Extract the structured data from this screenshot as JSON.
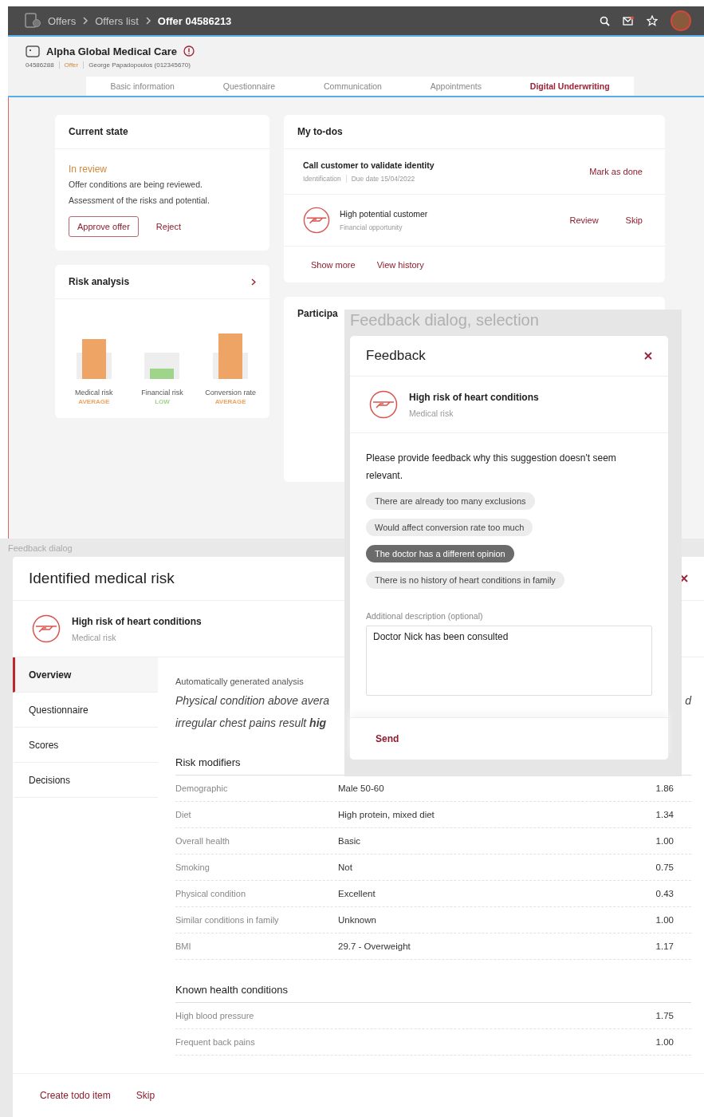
{
  "app_bar": {
    "breadcrumbs": [
      {
        "label": "Offers",
        "current": false
      },
      {
        "label": "Offers list",
        "current": false
      },
      {
        "label": "Offer 04586213",
        "current": true
      }
    ]
  },
  "record": {
    "title": "Alpha Global Medical Care",
    "number": "04586288",
    "type": "Offer",
    "person": "George Papadopoulos (012345670)"
  },
  "tabs": [
    {
      "label": "Basic information",
      "selected": false
    },
    {
      "label": "Questionnaire",
      "selected": false
    },
    {
      "label": "Communication",
      "selected": false
    },
    {
      "label": "Appointments",
      "selected": false
    },
    {
      "label": "Digital Underwriting",
      "selected": true
    }
  ],
  "current_state": {
    "title": "Current state",
    "status": "In review",
    "description": "Offer conditions are being reviewed. Assessment of the risks and potential.",
    "buttons": [
      {
        "label": "Approve offer",
        "kind": "outlined"
      },
      {
        "label": "Reject",
        "kind": "text"
      }
    ]
  },
  "risk_analysis": {
    "title": "Risk analysis",
    "metrics": [
      {
        "label": "Medical risk",
        "rating": "AVERAGE",
        "color": "#eea464",
        "level": 0.83
      },
      {
        "label": "Financial risk",
        "rating": "LOW",
        "color": "#9fd58a",
        "level": 0.22
      },
      {
        "label": "Conversion rate",
        "rating": "AVERAGE",
        "color": "#eea464",
        "level": 0.95
      }
    ]
  },
  "todos": {
    "title": "My to-dos",
    "items": [
      {
        "kind": "task",
        "title": "Call customer to validate identity",
        "category": "Identification",
        "due": "Due date 15/04/2022",
        "actions": [
          "Mark as done"
        ]
      },
      {
        "kind": "suggestion",
        "title": "High potential customer",
        "subtitle": "Financial opportunity",
        "actions": [
          "Review",
          "Skip"
        ]
      }
    ],
    "links": [
      "Show more",
      "View history"
    ]
  },
  "participants": {
    "title": "Participa"
  },
  "medical_frame": {
    "caption": "Feedback dialog",
    "dialog": {
      "title": "Identified medical risk",
      "suggestion": {
        "title": "High risk of heart conditions",
        "subtitle": "Medical risk"
      },
      "nav": [
        {
          "label": "Overview",
          "selected": true
        },
        {
          "label": "Questionnaire",
          "selected": false
        },
        {
          "label": "Scores",
          "selected": false
        },
        {
          "label": "Decisions",
          "selected": false
        }
      ],
      "analysis": {
        "label": "Automatically generated analysis",
        "lines": [
          "Physical condition above avera",
          "irregular chest pains result **hig**"
        ],
        "overflow": "d"
      },
      "sections": [
        {
          "title": "Risk modifiers",
          "rows": [
            {
              "factor": "Demographic",
              "value": "Male 50-60",
              "score": "1.86"
            },
            {
              "factor": "Diet",
              "value": "High protein, mixed diet",
              "score": "1.34"
            },
            {
              "factor": "Overall health",
              "value": "Basic",
              "score": "1.00"
            },
            {
              "factor": "Smoking",
              "value": "Not",
              "score": "0.75"
            },
            {
              "factor": "Physical condition",
              "value": "Excellent",
              "score": "0.43"
            },
            {
              "factor": "Similar conditions in family",
              "value": "Unknown",
              "score": "1.00"
            },
            {
              "factor": "BMI",
              "value": "29.7 - Overweight",
              "score": "1.17"
            }
          ]
        },
        {
          "title": "Known health conditions",
          "rows": [
            {
              "factor": "High blood pressure",
              "score": "1.75"
            },
            {
              "factor": "Frequent back pains",
              "score": "1.00"
            }
          ]
        }
      ],
      "footer_actions": [
        "Create todo item",
        "Skip"
      ]
    }
  },
  "feedback_frame": {
    "caption": "Feedback dialog, selection",
    "dialog": {
      "title": "Feedback",
      "suggestion": {
        "title": "High risk of heart conditions",
        "subtitle": "Medical risk"
      },
      "prompt": "Please provide feedback why this suggestion doesn't seem relevant.",
      "reasons": [
        {
          "label": "There are already too many exclusions",
          "selected": false
        },
        {
          "label": "Would affect conversion rate too much",
          "selected": false
        },
        {
          "label": "The doctor has a different opinion",
          "selected": true
        },
        {
          "label": "There is no history of heart conditions in family",
          "selected": false
        }
      ],
      "description_label": "Additional description (optional)",
      "description": "Doctor Nick has been consulted",
      "send": "Send"
    }
  }
}
